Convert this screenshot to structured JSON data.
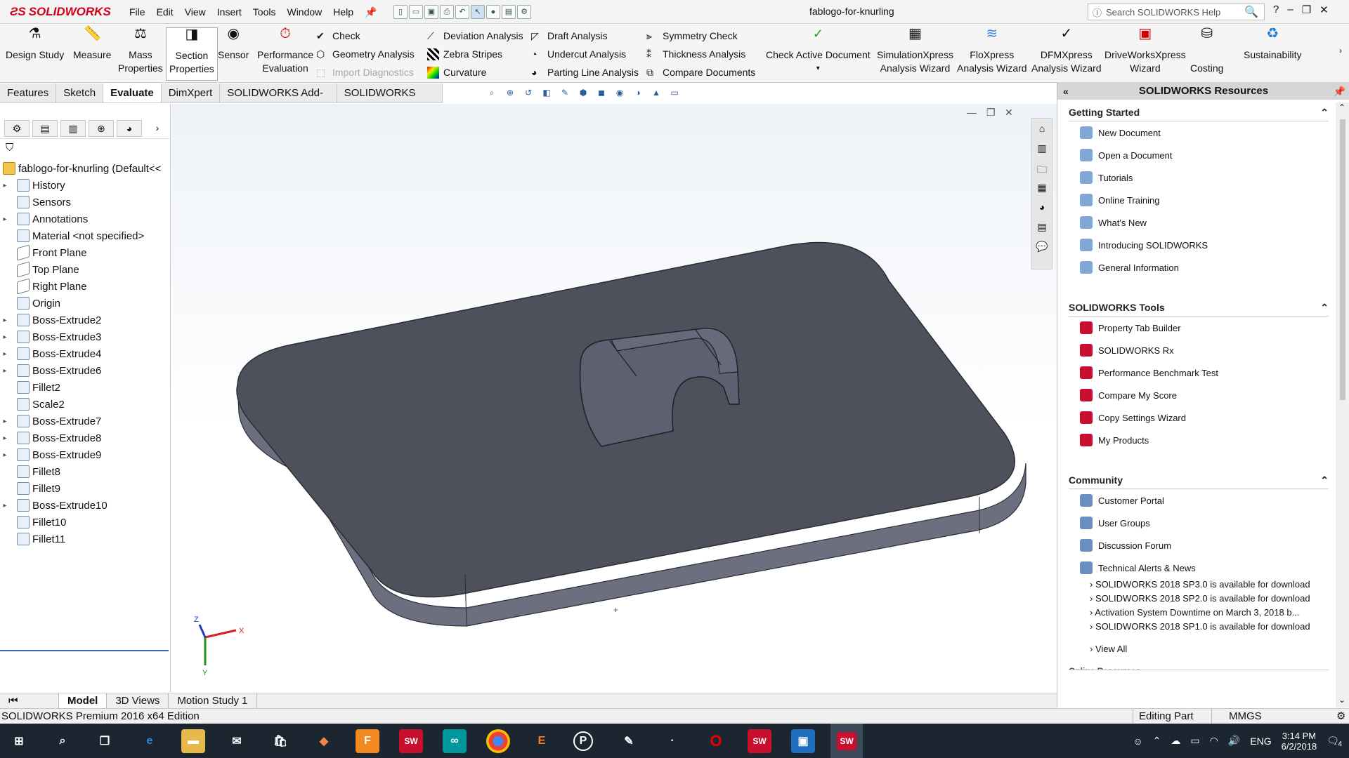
{
  "app": {
    "logo": "SOLIDWORKS",
    "document_title": "fablogo-for-knurling"
  },
  "menu": [
    "File",
    "Edit",
    "View",
    "Insert",
    "Tools",
    "Window",
    "Help"
  ],
  "search": {
    "placeholder": "Search SOLIDWORKS Help"
  },
  "window_controls": {
    "help": "?",
    "minimize": "–",
    "restore": "❐",
    "close": "✕"
  },
  "commands": {
    "design_study": "Design Study",
    "measure": "Measure",
    "mass_properties": [
      "Mass",
      "Properties"
    ],
    "section_properties": [
      "Section",
      "Properties"
    ],
    "sensor": "Sensor",
    "performance_evaluation": [
      "Performance",
      "Evaluation"
    ],
    "check": "Check",
    "geometry_analysis": "Geometry Analysis",
    "import_diagnostics": "Import Diagnostics",
    "deviation_analysis": "Deviation Analysis",
    "zebra_stripes": "Zebra Stripes",
    "curvature": "Curvature",
    "draft_analysis": "Draft Analysis",
    "undercut_analysis": "Undercut Analysis",
    "parting_line_analysis": "Parting Line Analysis",
    "symmetry_check": "Symmetry Check",
    "thickness_analysis": "Thickness Analysis",
    "compare_documents": "Compare Documents",
    "check_active_document": "Check Active Document",
    "simulationxpress": [
      "SimulationXpress",
      "Analysis Wizard"
    ],
    "floxpress": [
      "FloXpress",
      "Analysis Wizard"
    ],
    "dfmxpress": [
      "DFMXpress",
      "Analysis Wizard"
    ],
    "driveworksxpress": [
      "DriveWorksXpress",
      "Wizard"
    ],
    "costing": "Costing",
    "sustainability": "Sustainability"
  },
  "command_tabs": [
    "Features",
    "Sketch",
    "Evaluate",
    "DimXpert",
    "SOLIDWORKS Add-Ins",
    "SOLIDWORKS MBD"
  ],
  "active_command_tab": "Evaluate",
  "feature_tree": {
    "root": "fablogo-for-knurling  (Default<<",
    "items": [
      {
        "label": "History",
        "expandable": true
      },
      {
        "label": "Sensors",
        "expandable": false
      },
      {
        "label": "Annotations",
        "expandable": true
      },
      {
        "label": "Material <not specified>",
        "expandable": false
      },
      {
        "label": "Front Plane",
        "expandable": false
      },
      {
        "label": "Top Plane",
        "expandable": false
      },
      {
        "label": "Right Plane",
        "expandable": false
      },
      {
        "label": "Origin",
        "expandable": false
      },
      {
        "label": "Boss-Extrude2",
        "expandable": true
      },
      {
        "label": "Boss-Extrude3",
        "expandable": true
      },
      {
        "label": "Boss-Extrude4",
        "expandable": true
      },
      {
        "label": "Boss-Extrude6",
        "expandable": true
      },
      {
        "label": "Fillet2",
        "expandable": false
      },
      {
        "label": "Scale2",
        "expandable": false
      },
      {
        "label": "Boss-Extrude7",
        "expandable": true
      },
      {
        "label": "Boss-Extrude8",
        "expandable": true
      },
      {
        "label": "Boss-Extrude9",
        "expandable": true
      },
      {
        "label": "Fillet8",
        "expandable": false
      },
      {
        "label": "Fillet9",
        "expandable": false
      },
      {
        "label": "Boss-Extrude10",
        "expandable": true
      },
      {
        "label": "Fillet10",
        "expandable": false
      },
      {
        "label": "Fillet11",
        "expandable": false
      }
    ]
  },
  "triad": {
    "x": "X",
    "y": "Y",
    "z": "Z"
  },
  "resources": {
    "title": "SOLIDWORKS Resources",
    "getting_started": {
      "heading": "Getting Started",
      "items": [
        "New Document",
        "Open a Document",
        "Tutorials",
        "Online Training",
        "What's New",
        "Introducing SOLIDWORKS",
        "General Information"
      ]
    },
    "tools": {
      "heading": "SOLIDWORKS Tools",
      "items": [
        "Property Tab Builder",
        "SOLIDWORKS Rx",
        "Performance Benchmark Test",
        "Compare My Score",
        "Copy Settings Wizard",
        "My Products"
      ]
    },
    "community": {
      "heading": "Community",
      "items": [
        "Customer Portal",
        "User Groups",
        "Discussion Forum",
        "Technical Alerts & News"
      ]
    },
    "news": [
      "SOLIDWORKS 2018 SP3.0 is available for download",
      "SOLIDWORKS 2018 SP2.0 is available for download",
      "Activation System Downtime on March 3, 2018 b...",
      "SOLIDWORKS 2018 SP1.0 is available for download"
    ],
    "view_all": "View All",
    "online_resources": "Online Resources"
  },
  "model_tabs": [
    "Model",
    "3D Views",
    "Motion Study 1"
  ],
  "active_model_tab": "Model",
  "status": {
    "left": "SOLIDWORKS Premium 2016 x64 Edition",
    "mode": "Editing Part",
    "units": "MMGS"
  },
  "taskbar": {
    "lang": "ENG",
    "time": "3:14 PM",
    "date": "6/2/2018",
    "notifications": "4"
  },
  "colors": {
    "accent_red": "#d0021b",
    "part_top": "#4e505c",
    "part_side": "#6c6f80",
    "taskbar": "#1b2631"
  }
}
